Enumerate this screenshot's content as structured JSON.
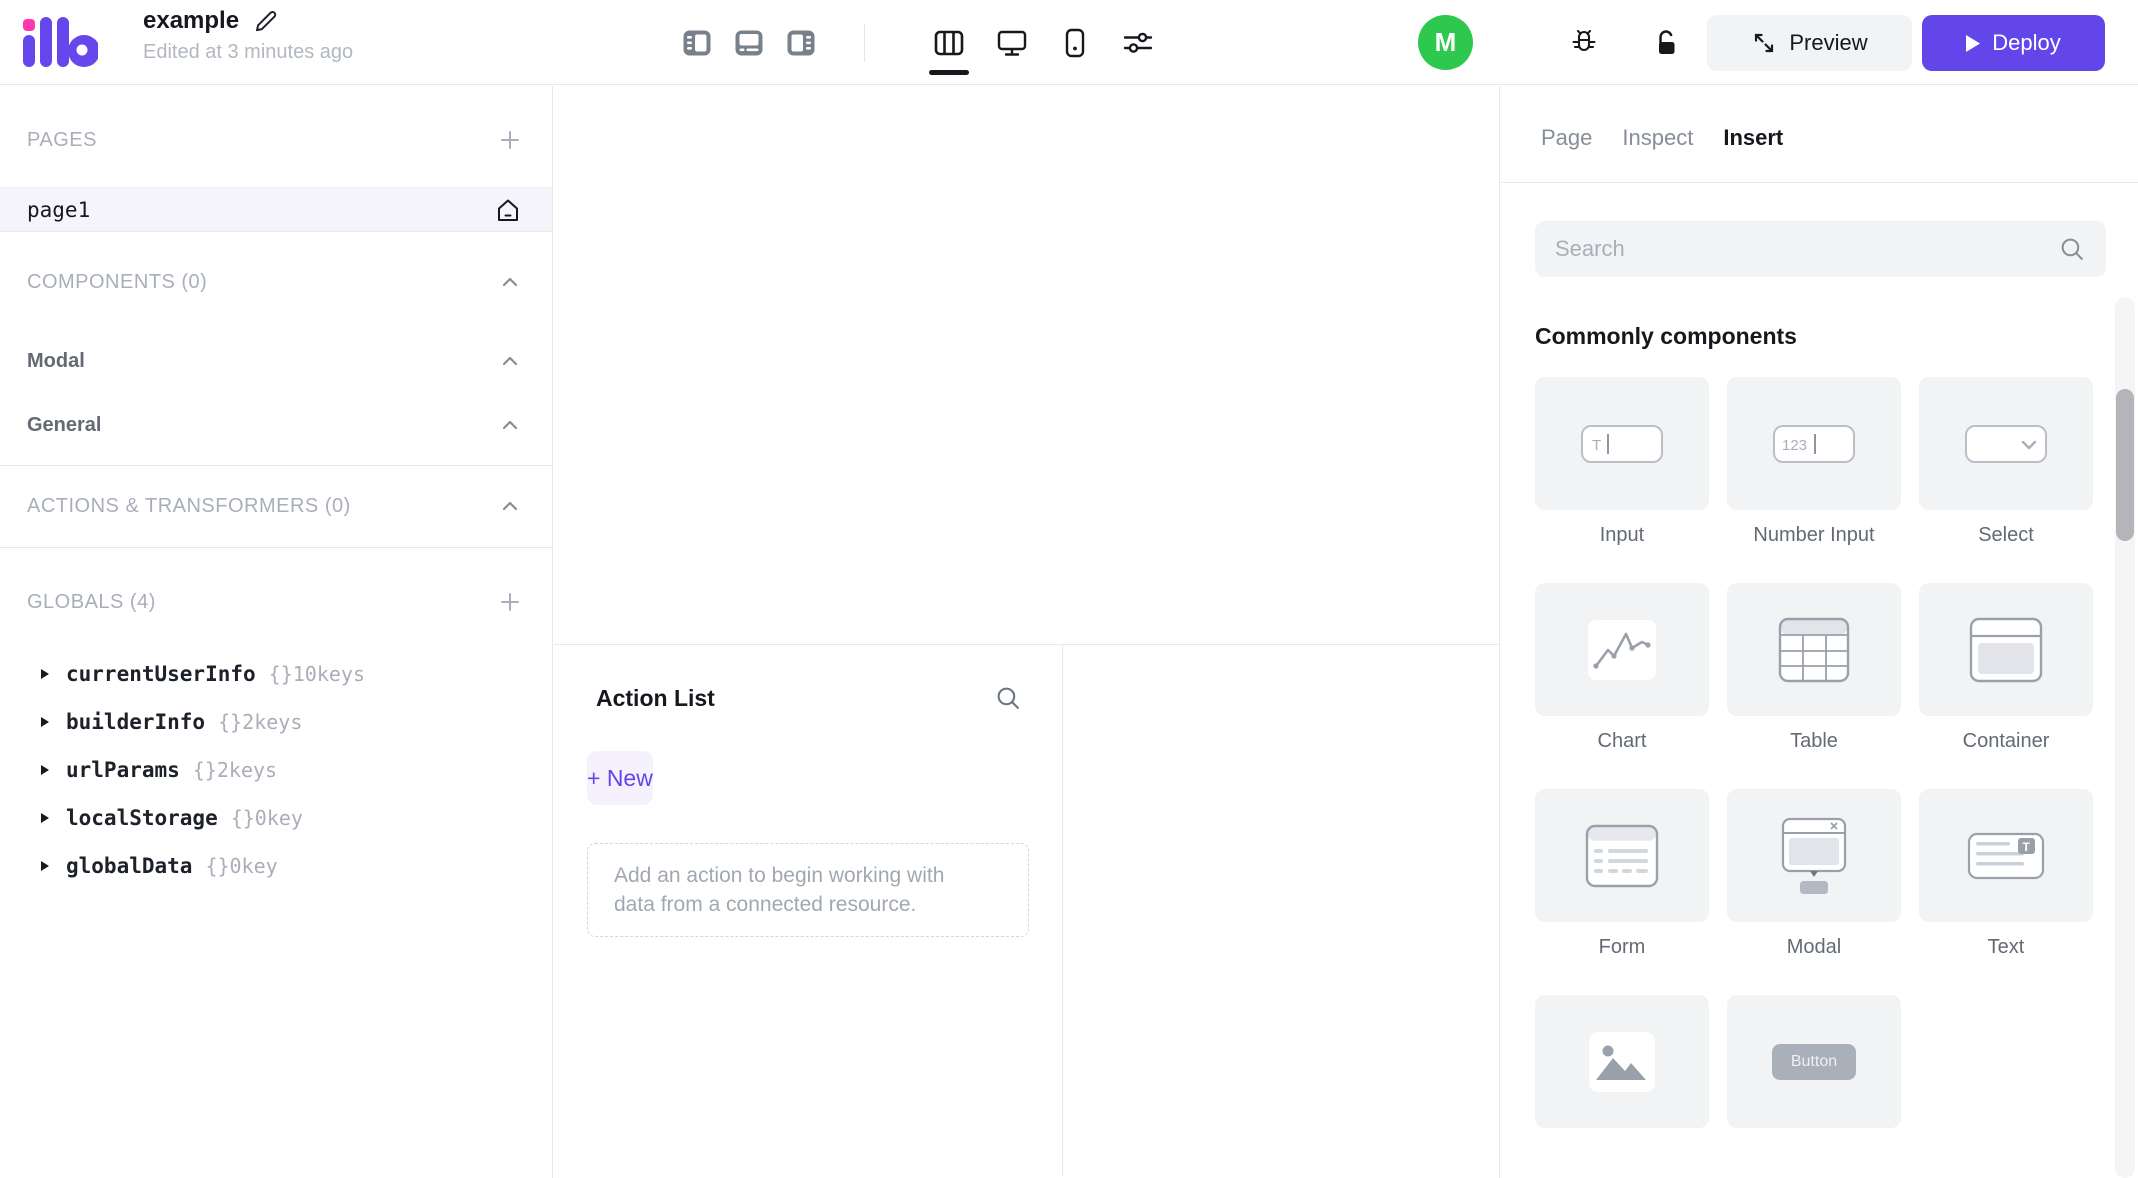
{
  "topbar": {
    "app_title": "example",
    "edited_status": "Edited at 3 minutes ago",
    "avatar_initial": "M",
    "preview_label": "Preview",
    "deploy_label": "Deploy"
  },
  "left_sidebar": {
    "pages": {
      "header": "PAGES",
      "items": [
        {
          "name": "page1"
        }
      ]
    },
    "components": {
      "header": "COMPONENTS (0)",
      "groups": [
        {
          "label": "Modal"
        },
        {
          "label": "General"
        }
      ]
    },
    "actions": {
      "header": "ACTIONS & TRANSFORMERS (0)"
    },
    "globals": {
      "header": "GLOBALS (4)",
      "items": [
        {
          "name": "currentUserInfo",
          "value": "{}10keys"
        },
        {
          "name": "builderInfo",
          "value": "{}2keys"
        },
        {
          "name": "urlParams",
          "value": "{}2keys"
        },
        {
          "name": "localStorage",
          "value": "{}0key"
        },
        {
          "name": "globalData",
          "value": "{}0key"
        }
      ]
    }
  },
  "action_panel": {
    "title": "Action List",
    "new_button_label": "+ New",
    "empty_hint": "Add an action to begin working with data from a connected resource."
  },
  "right_panel": {
    "tabs": [
      {
        "label": "Page",
        "active": false
      },
      {
        "label": "Inspect",
        "active": false
      },
      {
        "label": "Insert",
        "active": true
      }
    ],
    "search_placeholder": "Search",
    "section_title": "Commonly components",
    "components": [
      {
        "label": "Input"
      },
      {
        "label": "Number Input"
      },
      {
        "label": "Select"
      },
      {
        "label": "Chart"
      },
      {
        "label": "Table"
      },
      {
        "label": "Container"
      },
      {
        "label": "Form"
      },
      {
        "label": "Modal"
      },
      {
        "label": "Text"
      }
    ],
    "button_preview_label": "Button"
  },
  "colors": {
    "brand_purple": "#6246e9",
    "light_purple_bg": "#f5f2fd",
    "avatar_green": "#2dc84d",
    "logo_pink": "#ff38b1",
    "border": "#e8e9ed",
    "card_bg": "#f2f3f5"
  }
}
